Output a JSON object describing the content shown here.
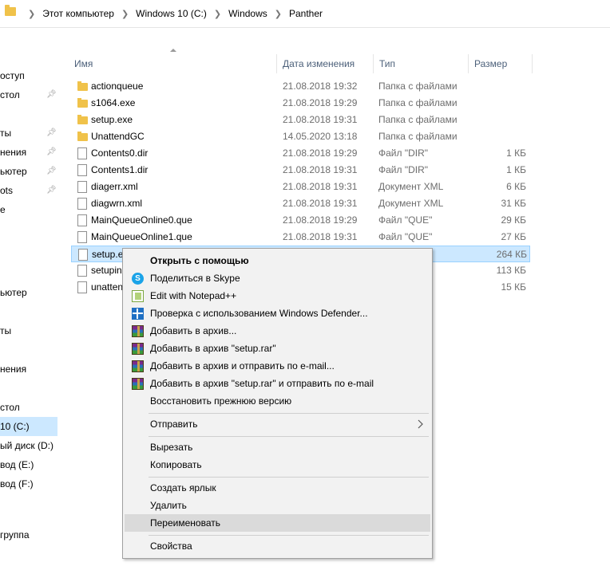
{
  "breadcrumb": [
    "Этот компьютер",
    "Windows 10 (C:)",
    "Windows",
    "Panther"
  ],
  "nav": {
    "items": [
      {
        "label": "оступ",
        "pinned": false
      },
      {
        "label": "стол",
        "pinned": true
      },
      {
        "label": "ты",
        "pinned": true
      },
      {
        "label": "нения",
        "pinned": true
      },
      {
        "label": "ьютер",
        "pinned": true
      },
      {
        "label": "ots",
        "pinned": true
      },
      {
        "label": "e",
        "pinned": false
      },
      {
        "label": "ьютер",
        "pinned": false
      },
      {
        "label": "ты",
        "pinned": false
      },
      {
        "label": "нения",
        "pinned": false
      },
      {
        "label": "стол",
        "pinned": false
      },
      {
        "label": "10 (C:)",
        "pinned": false,
        "selected": true
      },
      {
        "label": "ый диск (D:)",
        "pinned": false
      },
      {
        "label": "вод (E:)",
        "pinned": false
      },
      {
        "label": "вод (F:)",
        "pinned": false
      },
      {
        "label": "группа",
        "pinned": false
      }
    ]
  },
  "columns": {
    "name": "Имя",
    "date": "Дата изменения",
    "type": "Тип",
    "size": "Размер"
  },
  "files": [
    {
      "name": "actionqueue",
      "date": "21.08.2018 19:32",
      "type": "Папка с файлами",
      "size": "",
      "kind": "folder"
    },
    {
      "name": "s1064.exe",
      "date": "21.08.2018 19:29",
      "type": "Папка с файлами",
      "size": "",
      "kind": "folder"
    },
    {
      "name": "setup.exe",
      "date": "21.08.2018 19:31",
      "type": "Папка с файлами",
      "size": "",
      "kind": "folder"
    },
    {
      "name": "UnattendGC",
      "date": "14.05.2020 13:18",
      "type": "Папка с файлами",
      "size": "",
      "kind": "folder"
    },
    {
      "name": "Contents0.dir",
      "date": "21.08.2018 19:29",
      "type": "Файл \"DIR\"",
      "size": "1 КБ",
      "kind": "file"
    },
    {
      "name": "Contents1.dir",
      "date": "21.08.2018 19:31",
      "type": "Файл \"DIR\"",
      "size": "1 КБ",
      "kind": "file"
    },
    {
      "name": "diagerr.xml",
      "date": "21.08.2018 19:31",
      "type": "Документ XML",
      "size": "6 КБ",
      "kind": "file"
    },
    {
      "name": "diagwrn.xml",
      "date": "21.08.2018 19:31",
      "type": "Документ XML",
      "size": "31 КБ",
      "kind": "file"
    },
    {
      "name": "MainQueueOnline0.que",
      "date": "21.08.2018 19:29",
      "type": "Файл \"QUE\"",
      "size": "29 КБ",
      "kind": "file"
    },
    {
      "name": "MainQueueOnline1.que",
      "date": "21.08.2018 19:31",
      "type": "Файл \"QUE\"",
      "size": "27 КБ",
      "kind": "file"
    },
    {
      "name": "setup.e",
      "date": "",
      "type": "",
      "size": "264 КБ",
      "kind": "file",
      "selected": true
    },
    {
      "name": "setupin",
      "date": "",
      "type": "",
      "size": "113 КБ",
      "kind": "file"
    },
    {
      "name": "unatten",
      "date": "",
      "type": "",
      "size": "15 КБ",
      "kind": "file"
    }
  ],
  "context_menu": {
    "items": [
      {
        "label": "Открыть с помощью",
        "bold": true,
        "icon": ""
      },
      {
        "label": "Поделиться в Skype",
        "icon": "skype-icon"
      },
      {
        "label": "Edit with Notepad++",
        "icon": "notepad-plus-plus-icon"
      },
      {
        "label": "Проверка с использованием Windows Defender...",
        "icon": "windows-defender-icon"
      },
      {
        "label": "Добавить в архив...",
        "icon": "winrar-icon"
      },
      {
        "label": "Добавить в архив \"setup.rar\"",
        "icon": "winrar-icon"
      },
      {
        "label": "Добавить в архив и отправить по e-mail...",
        "icon": "winrar-icon"
      },
      {
        "label": "Добавить в архив \"setup.rar\" и отправить по e-mail",
        "icon": "winrar-icon"
      },
      {
        "label": "Восстановить прежнюю версию",
        "icon": ""
      },
      {
        "label": "Отправить",
        "icon": "",
        "submenu": true
      },
      {
        "label": "Вырезать",
        "icon": ""
      },
      {
        "label": "Копировать",
        "icon": ""
      },
      {
        "label": "Создать ярлык",
        "icon": ""
      },
      {
        "label": "Удалить",
        "icon": ""
      },
      {
        "label": "Переименовать",
        "icon": "",
        "hovered": true
      },
      {
        "label": "Свойства",
        "icon": ""
      }
    ]
  }
}
